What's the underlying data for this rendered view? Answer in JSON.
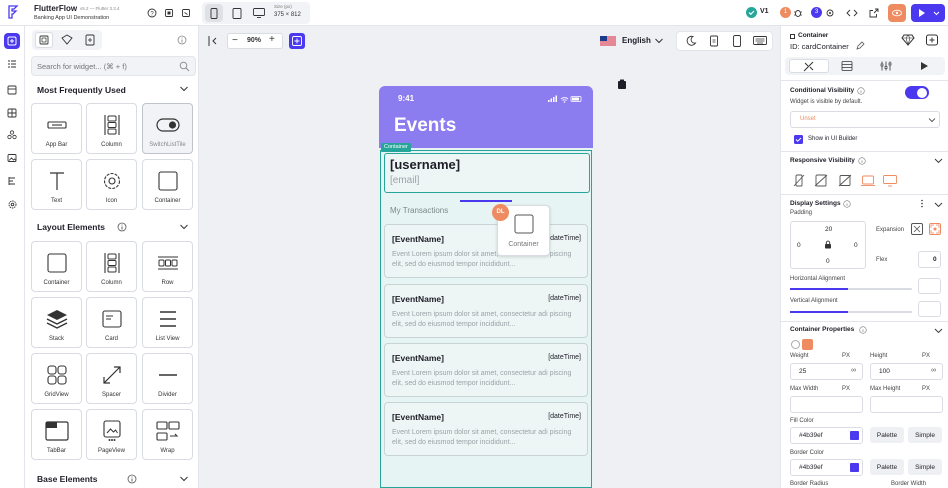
{
  "app": {
    "name": "FlutterFlow",
    "version": "v5.2 — Flutter 3.3.4",
    "project": "Banking App UI Demonstration",
    "size_label": "Size (px)",
    "size_value": "375 × 812",
    "version_badge": "V1",
    "collab_1_count": "1",
    "collab_2_count": "3"
  },
  "panel": {
    "search_placeholder": "Search for widget... (⌘ + f)",
    "sections": {
      "frequent": "Most Frequently Used",
      "layout": "Layout Elements",
      "base": "Base Elements"
    },
    "frequent_tiles": [
      {
        "label": "App Bar",
        "icon": "app-bar-icon"
      },
      {
        "label": "Column",
        "icon": "column-icon"
      },
      {
        "label": "SwitchListTile",
        "icon": "switch-icon"
      },
      {
        "label": "Text",
        "icon": "text-icon"
      },
      {
        "label": "Icon",
        "icon": "gear-icon"
      },
      {
        "label": "Container",
        "icon": "container-icon"
      }
    ],
    "layout_tiles": [
      {
        "label": "Container",
        "icon": "container-icon"
      },
      {
        "label": "Column",
        "icon": "column-icon"
      },
      {
        "label": "Row",
        "icon": "row-icon"
      },
      {
        "label": "Stack",
        "icon": "stack-icon"
      },
      {
        "label": "Card",
        "icon": "card-icon"
      },
      {
        "label": "List View",
        "icon": "list-view-icon"
      },
      {
        "label": "GridView",
        "icon": "grid-icon"
      },
      {
        "label": "Spacer",
        "icon": "spacer-icon"
      },
      {
        "label": "Divider",
        "icon": "divider-icon"
      },
      {
        "label": "TabBar",
        "icon": "tabbar-icon"
      },
      {
        "label": "PageView",
        "icon": "pageview-icon"
      },
      {
        "label": "Wrap",
        "icon": "wrap-icon"
      }
    ]
  },
  "canvas": {
    "zoom": "90%",
    "language": "English",
    "container_tag": "Container",
    "drag_label": "Container",
    "drag_avatar": "DL",
    "phone": {
      "time": "9:41",
      "title": "Events",
      "username": "[username]",
      "email": "[email]",
      "section_label": "My Transactions",
      "events": [
        {
          "name": "[EventName]",
          "date": "[dateTime]",
          "desc": "Event Lorem ipsum dolor sit amet, consectetur adi piscing elit, sed do eiusmod tempor incididunt..."
        },
        {
          "name": "[EventName]",
          "date": "[dateTime]",
          "desc": "Event Lorem ipsum dolor sit amet, consectetur adi piscing elit, sed do eiusmod tempor incididunt..."
        },
        {
          "name": "[EventName]",
          "date": "[dateTime]",
          "desc": "Event Lorem ipsum dolor sit amet, consectetur adi piscing elit, sed do eiusmod tempor incididunt..."
        },
        {
          "name": "[EventName]",
          "date": "[dateTime]",
          "desc": "Event Lorem ipsum dolor sit amet, consectetur adi piscing elit, sed do eiusmod tempor incididunt..."
        }
      ]
    }
  },
  "props": {
    "widget_type": "Container",
    "widget_id": "ID: cardContainer",
    "conditional_visibility": {
      "title": "Conditional Visibility",
      "desc": "Widget is visible by default.",
      "enabled": true,
      "unset": "Unset",
      "show_in_builder": "Show in UI Builder"
    },
    "responsive_visibility": "Responsive Visibility",
    "display_settings": {
      "title": "Display Settings",
      "padding_label": "Padding",
      "padding_top": "20",
      "padding_left": "0",
      "padding_right": "0",
      "padding_bottom": "0",
      "expansion_label": "Expansion",
      "flex_label": "Flex",
      "flex_value": "0",
      "horizontal_alignment": "Horizontal Alignment",
      "vertical_alignment": "Vertical Alignment"
    },
    "container_properties": {
      "title": "Container Properties",
      "width_label": "Weight",
      "width_unit": "PX",
      "width_value": "25",
      "height_label": "Height",
      "height_unit": "PX",
      "height_value": "100",
      "max_width_label": "Max Width",
      "max_width_unit": "PX",
      "max_height_label": "Max Height",
      "max_height_unit": "PX",
      "fill_color_label": "Fill Color",
      "fill_color_value": "#4b39ef",
      "border_color_label": "Border Color",
      "border_color_value": "#4b39ef",
      "palette_label": "Palette",
      "simple_label": "Simple",
      "border_radius_label": "Border Radius",
      "border_width_label": "Border Width"
    }
  },
  "colors": {
    "accent": "#4b39ef",
    "phone_header": "#8b7cf0",
    "selection": "#26a69a",
    "orange": "#ee8b60"
  }
}
